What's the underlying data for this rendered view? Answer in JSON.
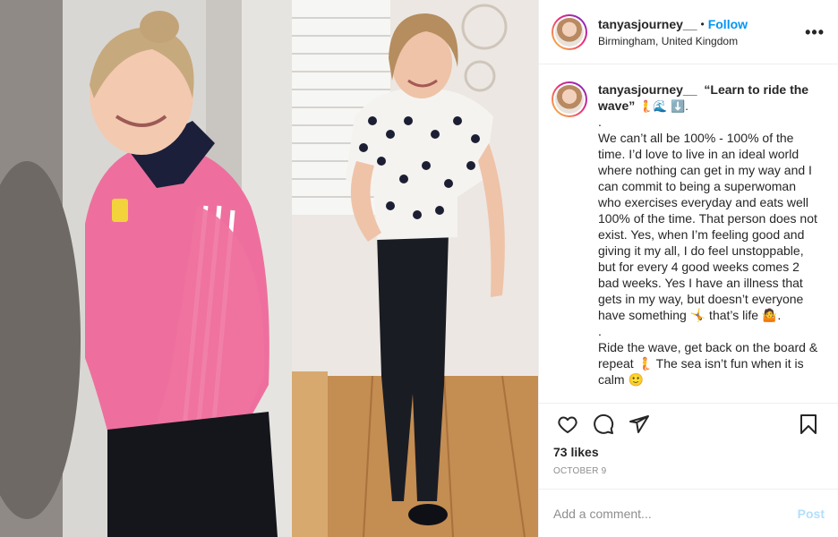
{
  "header": {
    "username": "tanyasjourney__",
    "separator": "•",
    "follow_label": "Follow",
    "location": "Birmingham, United Kingdom",
    "more_label": "•••"
  },
  "caption": {
    "username": "tanyasjourney__",
    "title": "“Learn to ride the wave”",
    "title_emojis": "🧜🌊 ⬇️.",
    "lines": [
      ".",
      "We can’t all be 100% - 100% of the time. I’d love to live in an ideal world where nothing can get in my way and I can commit to being a superwoman who exercises everyday and eats well 100% of the time. That person does not exist. Yes, when I’m feeling good and giving it my all, I do feel unstoppable, but for every 4 good weeks comes 2 bad weeks. Yes I have an illness that gets in my way, but doesn’t everyone have something 🤸 that’s life 🤷.",
      ".",
      "Ride the wave, get back on the board & repeat 🧜 The sea isn’t fun when it is calm 🙂"
    ]
  },
  "actions": {
    "like_icon": "heart-icon",
    "comment_icon": "comment-bubble-icon",
    "share_icon": "paper-plane-icon",
    "save_icon": "bookmark-icon"
  },
  "likes_text": "73 likes",
  "date_text": "OCTOBER 9",
  "comment_box": {
    "placeholder": "Add a comment...",
    "post_label": "Post"
  },
  "colors": {
    "accent": "#0095f6",
    "post_disabled": "#b2dffc",
    "muted": "#8e8e8e",
    "border": "#efefef"
  }
}
